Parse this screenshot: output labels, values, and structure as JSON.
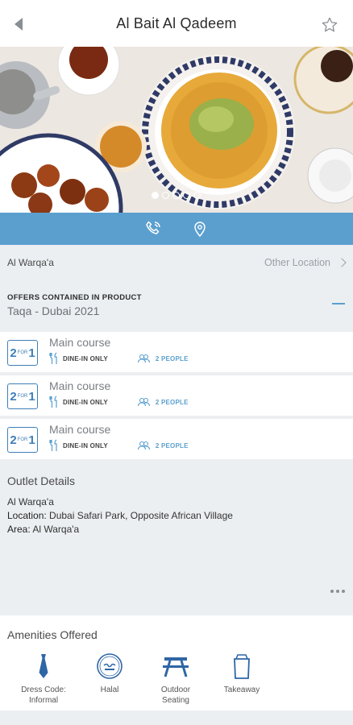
{
  "header": {
    "title": "Al Bait Al Qadeem",
    "back_icon": "back-arrow-icon",
    "favorite_icon": "star-icon"
  },
  "gallery": {
    "slide_count": 5,
    "active_index": 0
  },
  "actions": {
    "call_icon": "phone-icon",
    "map_icon": "location-pin-icon",
    "bar_color": "#5b9fcf"
  },
  "location": {
    "name": "Al Warqa'a",
    "other_label": "Other Location"
  },
  "offers": {
    "label": "OFFERS CONTAINED IN PRODUCT",
    "program": "Taqa - Dubai 2021",
    "items": [
      {
        "badge_left": "2",
        "badge_mid": "FOR",
        "badge_right": "1",
        "title": "Main course",
        "dine": "DINE-IN ONLY",
        "people": "2 PEOPLE"
      },
      {
        "badge_left": "2",
        "badge_mid": "FOR",
        "badge_right": "1",
        "title": "Main course",
        "dine": "DINE-IN ONLY",
        "people": "2 PEOPLE"
      },
      {
        "badge_left": "2",
        "badge_mid": "FOR",
        "badge_right": "1",
        "title": "Main course",
        "dine": "DINE-IN ONLY",
        "people": "2 PEOPLE"
      }
    ]
  },
  "outlet": {
    "title": "Outlet Details",
    "name": "Al Warqa'a",
    "location_label": "Location:",
    "location_value": "Dubai Safari Park, Opposite African Village",
    "area_label": "Area:",
    "area_value": "Al Warqa'a"
  },
  "amenities": {
    "title": "Amenities Offered",
    "items": [
      {
        "line1": "Dress Code:",
        "line2": "Informal",
        "icon": "tie-icon"
      },
      {
        "line1": "Halal",
        "line2": "",
        "icon": "halal-icon"
      },
      {
        "line1": "Outdoor",
        "line2": "Seating",
        "icon": "picnic-table-icon"
      },
      {
        "line1": "Takeaway",
        "line2": "",
        "icon": "takeaway-bag-icon"
      }
    ]
  }
}
